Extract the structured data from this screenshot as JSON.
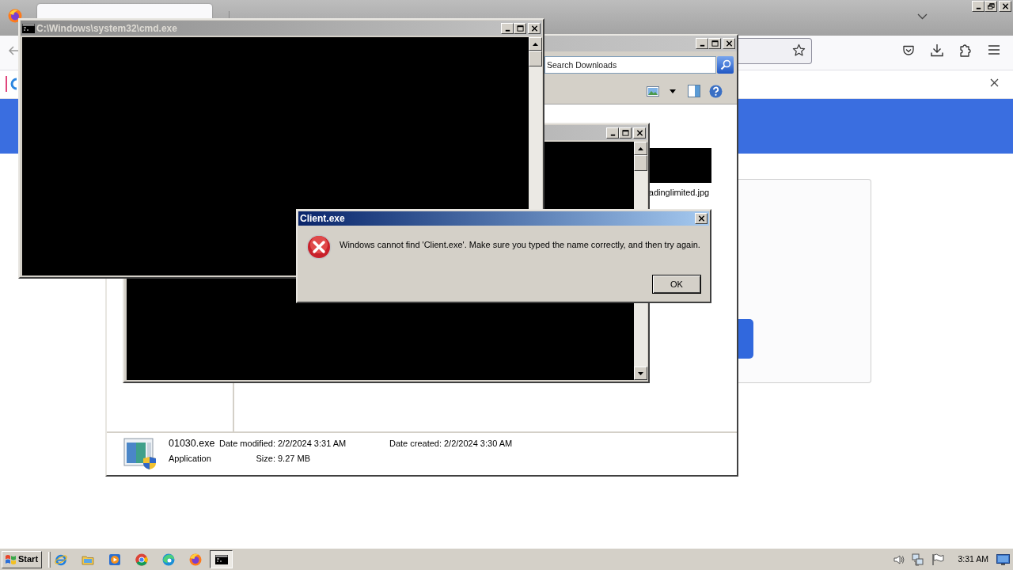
{
  "explorer": {
    "search": {
      "placeholder": "Search Downloads"
    },
    "items": [
      {
        "name": "adinglimited.jpg"
      }
    ],
    "details": {
      "file_name": "01030.exe",
      "file_type": "Application",
      "columns": [
        [
          {
            "label": "Date modified:",
            "value": "2/2/2024 3:31 AM"
          },
          {
            "label": "Size:",
            "value": "9.27 MB"
          }
        ],
        [
          {
            "label": "Date created:",
            "value": "2/2/2024 3:30 AM"
          }
        ]
      ]
    }
  },
  "console_window": {
    "title": "C:\\Windows\\system32\\cmd.exe"
  },
  "dialog": {
    "title": "Client.exe",
    "message": "Windows cannot find 'Client.exe'. Make sure you typed the name correctly, and then try again.",
    "buttons": [
      "OK"
    ]
  },
  "taskbar": {
    "start_label": "Start",
    "quick_launch": [
      {
        "kind": "ie"
      },
      {
        "kind": "folder"
      },
      {
        "kind": "media"
      },
      {
        "kind": "chrome"
      },
      {
        "kind": "edge"
      },
      {
        "kind": "firefox"
      }
    ],
    "windows": [
      {
        "kind": "console",
        "selected": true
      }
    ],
    "clock": "3:31 AM"
  }
}
